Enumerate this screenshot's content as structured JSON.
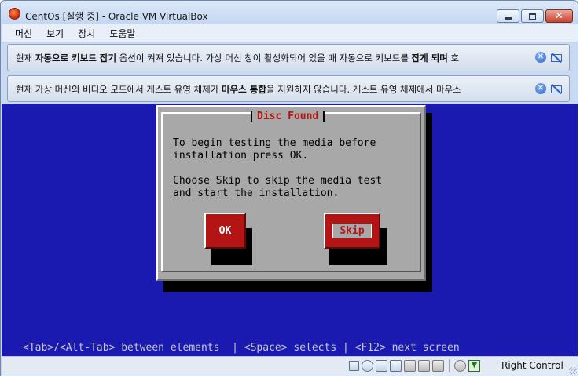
{
  "window": {
    "title": "CentOs [실행 중] - Oracle VM VirtualBox",
    "controls": [
      "minimize-icon",
      "maximize-icon",
      "close-icon"
    ]
  },
  "menubar": {
    "items": [
      "머신",
      "보기",
      "장치",
      "도움말"
    ]
  },
  "banners": [
    {
      "pre": "현재 ",
      "bold1": "자동으로 키보드 잡기",
      "mid": " 옵션이 켜져 있습니다. 가상 머신 창이 활성화되어 있을 때 자동으로 키보드를 ",
      "bold2": "잡게 되며",
      "post": " 호"
    },
    {
      "pre": "현재 가상 머신의 비디오 모드에서 게스트 유영 체제가 ",
      "bold1": "마우스 통합",
      "mid": "을 지원하지 않습니다. 게스트 유영 체제에서 마우스",
      "bold2": "",
      "post": ""
    }
  ],
  "guest": {
    "dialog_title": "Disc Found",
    "dialog_text": "To begin testing the media before\ninstallation press OK.\n\nChoose Skip to skip the media test\nand start the installation.",
    "ok_label": "OK",
    "skip_label": "Skip",
    "help_line": "<Tab>/<Alt-Tab> between elements  | <Space> selects | <F12> next screen",
    "colors": {
      "background": "#1b1ab0",
      "dialog": "#a8a8a8",
      "accent": "#b31515"
    }
  },
  "statusbar": {
    "icons": [
      "hard-disk-icon",
      "optical-drive-icon",
      "usb-icon",
      "network-icon",
      "shared-folders-icon",
      "display-icon",
      "capture-icon",
      "mouse-integration-icon",
      "keyboard-capture-icon"
    ],
    "host_key": "Right Control"
  }
}
